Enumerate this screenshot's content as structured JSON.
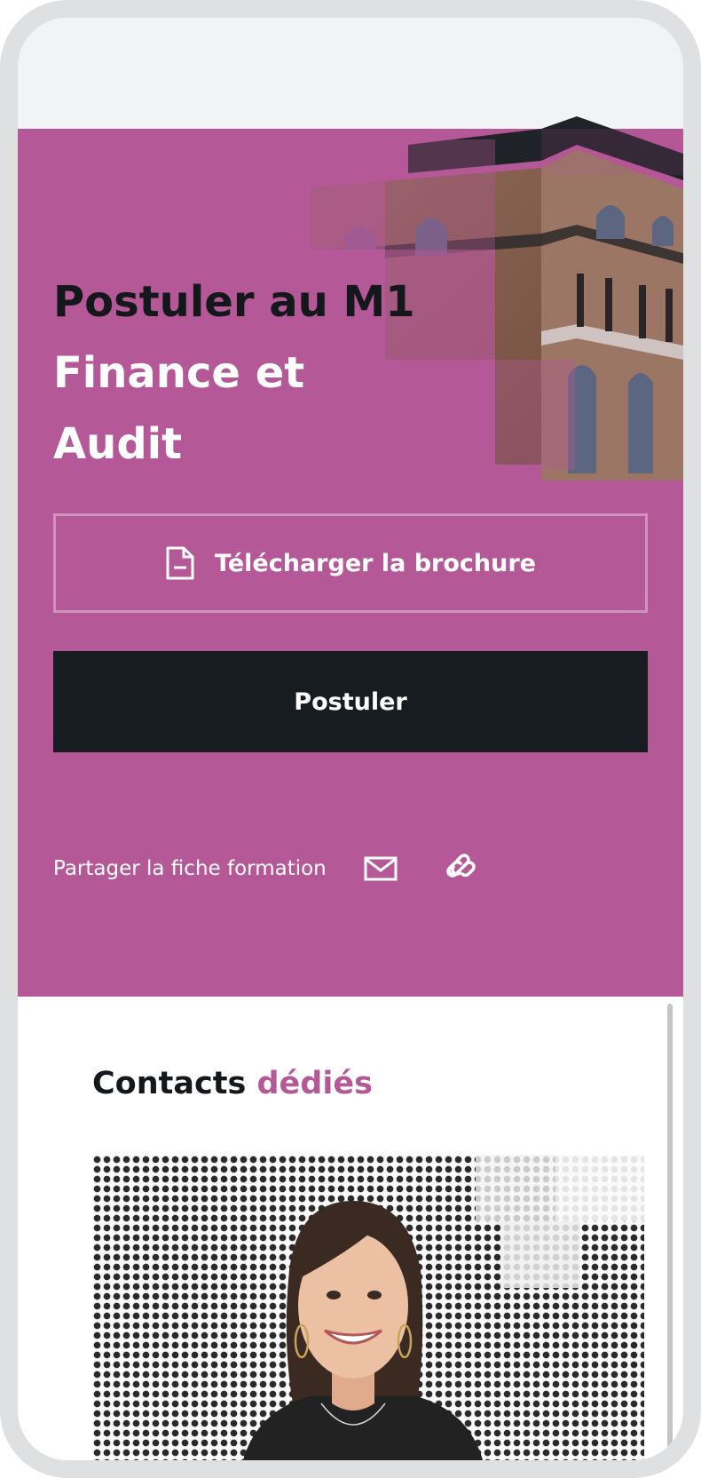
{
  "hero": {
    "title_dark": "Postuler au M1",
    "title_line2": "Finance et",
    "title_line3": "Audit",
    "brochure_label": "Télécharger la brochure",
    "apply_label": "Postuler",
    "share_label": "Partager la fiche formation"
  },
  "contacts": {
    "title_main": "Contacts",
    "title_accent": "dédiés"
  },
  "colors": {
    "brand": "#b55897",
    "dark": "#161c1f",
    "bg": "#f2f3f4"
  },
  "icons": [
    "document-icon",
    "mail-icon",
    "link-icon"
  ]
}
